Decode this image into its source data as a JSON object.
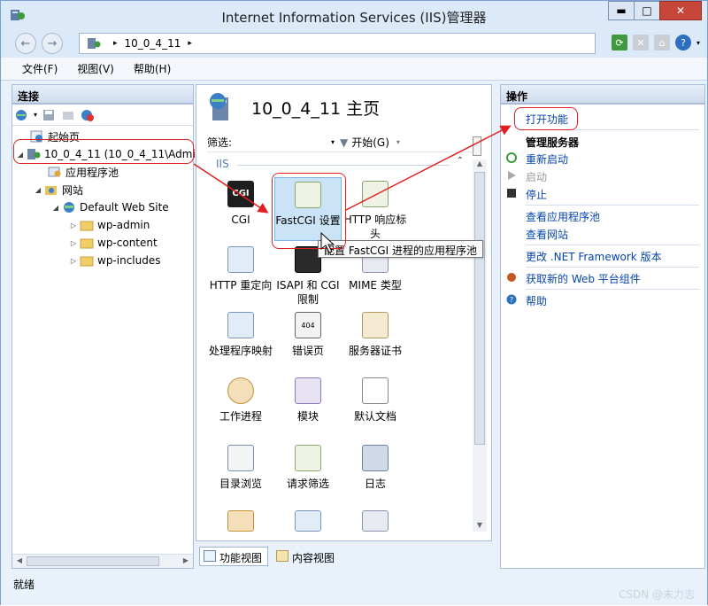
{
  "window": {
    "title": "Internet Information Services (IIS)管理器",
    "minimize": "▬",
    "maximize": "□",
    "close": "✕"
  },
  "address": {
    "segment": "10_0_4_11",
    "sep1": "▸",
    "sep2": "▸"
  },
  "menu": {
    "file": "文件(F)",
    "view": "视图(V)",
    "help": "帮助(H)"
  },
  "connections": {
    "header": "连接",
    "tree": {
      "start": "起始页",
      "server": "10_0_4_11 (10_0_4_11\\Admi",
      "apppools": "应用程序池",
      "sites": "网站",
      "default_site": "Default Web Site",
      "folder1": "wp-admin",
      "folder2": "wp-content",
      "folder3": "wp-includes"
    }
  },
  "center": {
    "title": "10_0_4_11 主页",
    "filter_label": "筛选:",
    "go_label": "开始(G)",
    "group": "IIS",
    "features": [
      {
        "label": "CGI"
      },
      {
        "label": "FastCGI 设置"
      },
      {
        "label": "HTTP 响应标头"
      },
      {
        "label": "HTTP 重定向"
      },
      {
        "label": "ISAPI 和 CGI 限制"
      },
      {
        "label": "MIME 类型"
      },
      {
        "label": "处理程序映射"
      },
      {
        "label": "错误页"
      },
      {
        "label": "服务器证书"
      },
      {
        "label": "工作进程"
      },
      {
        "label": "模块"
      },
      {
        "label": "默认文档"
      },
      {
        "label": "目录浏览"
      },
      {
        "label": "请求筛选"
      },
      {
        "label": "日志"
      }
    ],
    "tooltip": "配置 FastCGI 进程的应用程序池",
    "tab_features": "功能视图",
    "tab_content": "内容视图"
  },
  "actions": {
    "header": "操作",
    "open_feature": "打开功能",
    "manage_server": "管理服务器",
    "restart": "重新启动",
    "start": "启动",
    "stop": "停止",
    "view_apppools": "查看应用程序池",
    "view_sites": "查看网站",
    "change_net": "更改 .NET Framework 版本",
    "get_components": "获取新的 Web 平台组件",
    "help": "帮助"
  },
  "status": {
    "text": "就绪",
    "watermark": "CSDN @未力志"
  },
  "colors": {
    "accent": "#0645ad",
    "highlight": "#e02020",
    "selected_bg": "#cbe3f7"
  }
}
